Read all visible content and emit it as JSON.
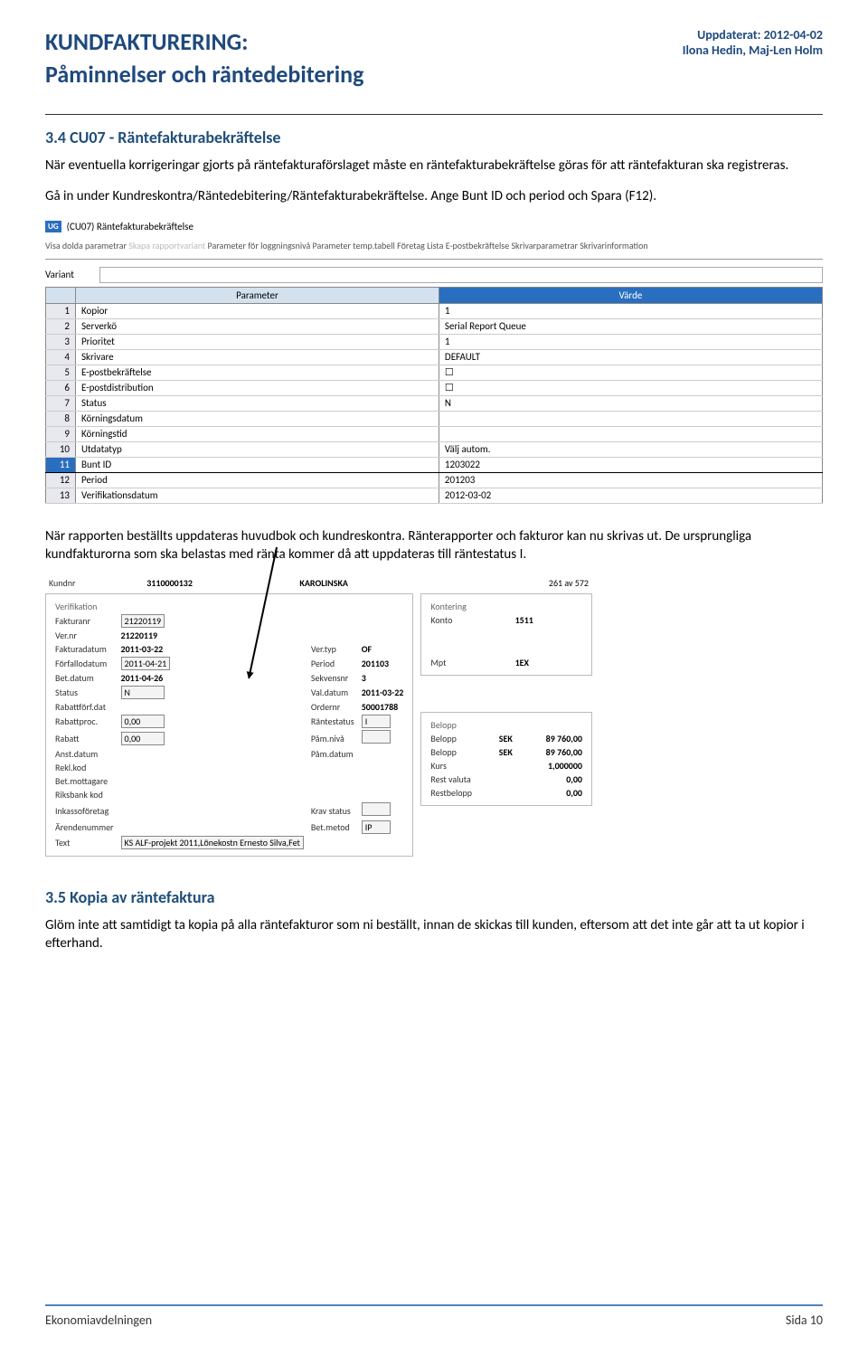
{
  "header": {
    "title_line1": "KUNDFAKTURERING:",
    "title_line2": "Påminnelser och räntedebitering",
    "updated": "Uppdaterat: 2012-04-02",
    "authors": "Ilona Hedin, Maj-Len Holm"
  },
  "section1": {
    "heading": "3.4 CU07 - Räntefakturabekräftelse",
    "para1": "När eventuella korrigeringar gjorts på räntefakturaförslaget måste en räntefakturabekräftelse göras för att räntefakturan ska registreras.",
    "para2": "Gå in under Kundreskontra/Räntedebitering/Räntefakturabekräftelse. Ange Bunt ID och period och Spara (F12)."
  },
  "shot1": {
    "window_title": "(CU07) Räntefakturabekräftelse",
    "menu": [
      "Visa dolda parametrar",
      "Skapa rapportvariant",
      "Parameter för loggningsnivå",
      "Parameter temp.tabell",
      "Företag",
      "Lista",
      "E-postbekräftelse",
      "Skrivarparametrar",
      "Skrivarinformation"
    ],
    "menu_dim_indexes": [
      1
    ],
    "variant_label": "Variant",
    "col_param": "Parameter",
    "col_value": "Värde",
    "rows": [
      {
        "n": "1",
        "p": "Kopior",
        "v": "1"
      },
      {
        "n": "2",
        "p": "Serverkö",
        "v": "Serial Report Queue"
      },
      {
        "n": "3",
        "p": "Prioritet",
        "v": "1"
      },
      {
        "n": "4",
        "p": "Skrivare",
        "v": "DEFAULT"
      },
      {
        "n": "5",
        "p": "E-postbekräftelse",
        "v": "☐"
      },
      {
        "n": "6",
        "p": "E-postdistribution",
        "v": "☐"
      },
      {
        "n": "7",
        "p": "Status",
        "v": "N"
      },
      {
        "n": "8",
        "p": "Körningsdatum",
        "v": ""
      },
      {
        "n": "9",
        "p": "Körningstid",
        "v": ""
      },
      {
        "n": "10",
        "p": "Utdatatyp",
        "v": "Välj autom."
      },
      {
        "n": "11",
        "p": "Bunt ID",
        "v": "1203022",
        "sel": true
      },
      {
        "n": "12",
        "p": "Period",
        "v": "201203"
      },
      {
        "n": "13",
        "p": "Verifikationsdatum",
        "v": "2012-03-02"
      }
    ]
  },
  "section2": {
    "para1": "När rapporten beställts uppdateras huvudbok och kundreskontra. Ränterapporter och fakturor kan nu skrivas ut. De ursprungliga kundfakturorna som ska belastas med ränta kommer då att uppdateras till räntestatus I."
  },
  "shot2": {
    "top": {
      "kundnr_l": "Kundnr",
      "kundnr": "3110000132",
      "kundnamn": "KAROLINSKA",
      "counter": "261 av 572"
    },
    "verif_title": "Verifikation",
    "left": [
      {
        "l": "Fakturanr",
        "f": "21220119"
      },
      {
        "l": "Ver.nr",
        "v": "21220119"
      },
      {
        "l": "Fakturadatum",
        "v": "2011-03-22",
        "l2": "Ver.typ",
        "v2": "OF"
      },
      {
        "l": "Förfallodatum",
        "f": "2011-04-21",
        "l2": "Period",
        "v2": "201103"
      },
      {
        "l": "Bet.datum",
        "v": "2011-04-26",
        "l2": "Sekvensnr",
        "v2": "3"
      },
      {
        "l": "Status",
        "f": "N",
        "l2": "Val.datum",
        "v2": "2011-03-22"
      },
      {
        "l": "Rabattförf.dat",
        "l2": "Ordernr",
        "v2": "50001788"
      },
      {
        "l": "Rabattproc.",
        "f": "0,00",
        "l2": "Räntestatus",
        "f2": "I"
      },
      {
        "l": "Rabatt",
        "f": "0,00",
        "l2": "Påm.nivå",
        "f2": ""
      },
      {
        "l": "Anst.datum",
        "l2": "Påm.datum"
      },
      {
        "l": "Rekl.kod"
      },
      {
        "l": "Bet.mottagare"
      },
      {
        "l": "Riksbank kod"
      },
      {
        "l": "Inkassoföretag",
        "l2": "Krav status",
        "f2": ""
      },
      {
        "l": "Ärendenummer",
        "l2": "Bet.metod",
        "f2": "IP"
      },
      {
        "l": "Text",
        "f": "KS ALF-projekt 2011,Lönekostn Ernesto Silva,Fet"
      }
    ],
    "kontering_title": "Kontering",
    "kont": [
      {
        "l": "Konto",
        "v": "1511"
      },
      {
        "l": "Mpt",
        "v": "1EX"
      }
    ],
    "belopp_title": "Belopp",
    "bel": [
      {
        "l": "Belopp",
        "c": "SEK",
        "v": "89 760,00"
      },
      {
        "l": "Belopp",
        "c": "SEK",
        "v": "89 760,00"
      },
      {
        "l": "Kurs",
        "c": "",
        "v": "1,000000"
      },
      {
        "l": "Rest valuta",
        "c": "",
        "v": "0,00"
      },
      {
        "l": "Restbelopp",
        "c": "",
        "v": "0,00"
      }
    ]
  },
  "section3": {
    "heading": "3.5 Kopia av räntefaktura",
    "para": "Glöm inte att samtidigt ta kopia på alla räntefakturor som ni beställt, innan de skickas till kunden, eftersom att det inte går att ta ut kopior i efterhand."
  },
  "footer": {
    "left": "Ekonomiavdelningen",
    "right": "Sida 10"
  }
}
